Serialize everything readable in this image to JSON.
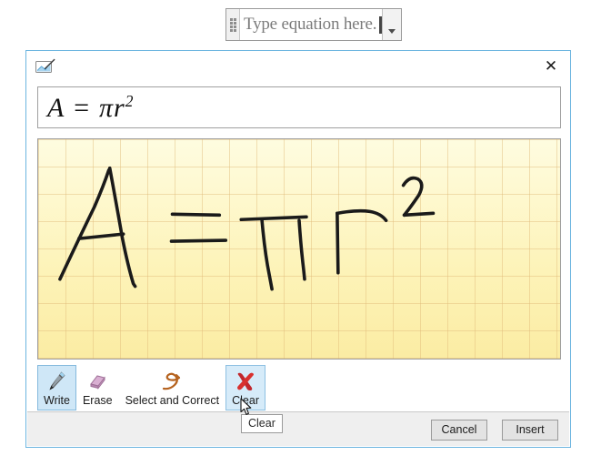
{
  "equation_control": {
    "placeholder_text": "Type equation here.",
    "handle_icon": "drag-handle-icon",
    "dropdown_icon": "chevron-down-icon"
  },
  "dialog": {
    "title": "",
    "app_icon": "ink-equation-icon",
    "close_label": "✕",
    "preview": {
      "base": "A = πr",
      "exponent": "2"
    },
    "canvas": {
      "name": "ink-writing-canvas",
      "written_equation": "A = πr²",
      "background_color": "#fdf3b8",
      "grid_color": "#e0b978"
    },
    "tools": [
      {
        "id": "write",
        "label": "Write",
        "icon": "pen-icon",
        "state": "selected"
      },
      {
        "id": "erase",
        "label": "Erase",
        "icon": "eraser-icon",
        "state": "normal"
      },
      {
        "id": "select-and-correct",
        "label": "Select and Correct",
        "icon": "lasso-icon",
        "state": "normal"
      },
      {
        "id": "clear",
        "label": "Clear",
        "icon": "red-x-icon",
        "state": "hovered"
      }
    ],
    "tooltip": {
      "text": "Clear"
    },
    "footer": {
      "cancel_label": "Cancel",
      "insert_label": "Insert"
    }
  },
  "colors": {
    "dialog_border": "#6cb5e0",
    "selected_tool_bg": "#cfe7f7",
    "footer_bg": "#efefef",
    "ink_color": "#1a1a1a",
    "clear_icon": "#cc2222",
    "eraser_icon": "#c9a0c4"
  }
}
